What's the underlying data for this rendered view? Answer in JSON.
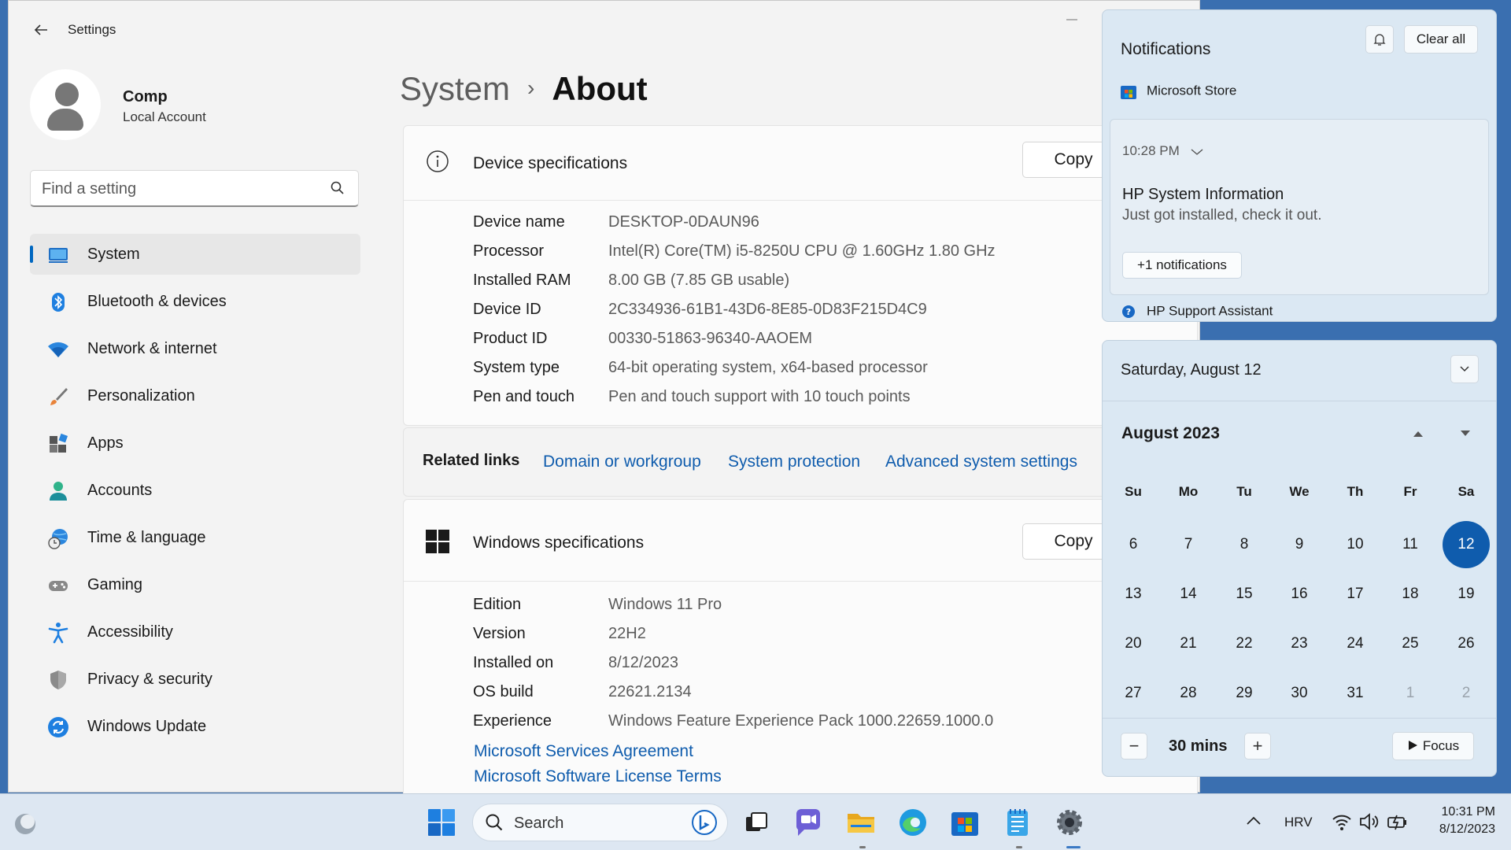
{
  "window": {
    "title": "Settings"
  },
  "profile": {
    "name": "Comp",
    "account_type": "Local Account"
  },
  "search": {
    "placeholder": "Find a setting"
  },
  "nav": {
    "items": [
      {
        "label": "System",
        "icon": "system-icon",
        "active": true
      },
      {
        "label": "Bluetooth & devices",
        "icon": "bluetooth-icon"
      },
      {
        "label": "Network & internet",
        "icon": "wifi-icon"
      },
      {
        "label": "Personalization",
        "icon": "brush-icon"
      },
      {
        "label": "Apps",
        "icon": "apps-icon"
      },
      {
        "label": "Accounts",
        "icon": "accounts-icon"
      },
      {
        "label": "Time & language",
        "icon": "globe-clock-icon"
      },
      {
        "label": "Gaming",
        "icon": "gamepad-icon"
      },
      {
        "label": "Accessibility",
        "icon": "accessibility-icon"
      },
      {
        "label": "Privacy & security",
        "icon": "shield-icon"
      },
      {
        "label": "Windows Update",
        "icon": "update-icon"
      }
    ]
  },
  "breadcrumb": {
    "parent": "System",
    "separator": "›",
    "current": "About"
  },
  "device_specs": {
    "title": "Device specifications",
    "copy_label": "Copy",
    "rows": [
      {
        "label": "Device name",
        "value": "DESKTOP-0DAUN96"
      },
      {
        "label": "Processor",
        "value": "Intel(R) Core(TM) i5-8250U CPU @ 1.60GHz   1.80 GHz"
      },
      {
        "label": "Installed RAM",
        "value": "8.00 GB (7.85 GB usable)"
      },
      {
        "label": "Device ID",
        "value": "2C334936-61B1-43D6-8E85-0D83F215D4C9"
      },
      {
        "label": "Product ID",
        "value": "00330-51863-96340-AAOEM"
      },
      {
        "label": "System type",
        "value": "64-bit operating system, x64-based processor"
      },
      {
        "label": "Pen and touch",
        "value": "Pen and touch support with 10 touch points"
      }
    ]
  },
  "related_links": {
    "label": "Related links",
    "links": [
      "Domain or workgroup",
      "System protection",
      "Advanced system settings"
    ]
  },
  "windows_specs": {
    "title": "Windows specifications",
    "copy_label": "Copy",
    "rows": [
      {
        "label": "Edition",
        "value": "Windows 11 Pro"
      },
      {
        "label": "Version",
        "value": "22H2"
      },
      {
        "label": "Installed on",
        "value": "8/12/2023"
      },
      {
        "label": "OS build",
        "value": "22621.2134"
      },
      {
        "label": "Experience",
        "value": "Windows Feature Experience Pack 1000.22659.1000.0"
      }
    ],
    "links": [
      "Microsoft Services Agreement",
      "Microsoft Software License Terms"
    ]
  },
  "notifications": {
    "title": "Notifications",
    "clear_all": "Clear all",
    "app1": "Microsoft Store",
    "toast": {
      "time": "10:28 PM",
      "title": "HP System Information",
      "body": "Just got installed, check it out.",
      "more": "+1 notifications"
    },
    "app2": "HP Support Assistant"
  },
  "calendar": {
    "date_header": "Saturday, August 12",
    "month_label": "August 2023",
    "weekdays": [
      "Su",
      "Mo",
      "Tu",
      "We",
      "Th",
      "Fr",
      "Sa"
    ],
    "weeks": [
      [
        "6",
        "7",
        "8",
        "9",
        "10",
        "11",
        "12"
      ],
      [
        "13",
        "14",
        "15",
        "16",
        "17",
        "18",
        "19"
      ],
      [
        "20",
        "21",
        "22",
        "23",
        "24",
        "25",
        "26"
      ],
      [
        "27",
        "28",
        "29",
        "30",
        "31",
        "1",
        "2"
      ]
    ],
    "today": "12",
    "focus": {
      "minus": "−",
      "duration": "30 mins",
      "plus": "+",
      "button": "Focus"
    }
  },
  "taskbar": {
    "search_label": "Search",
    "language": "HRV",
    "time": "10:31 PM",
    "date": "8/12/2023"
  },
  "colors": {
    "accent": "#0f5cad",
    "link": "#0f5cad",
    "today_bg": "#0f5cad"
  }
}
